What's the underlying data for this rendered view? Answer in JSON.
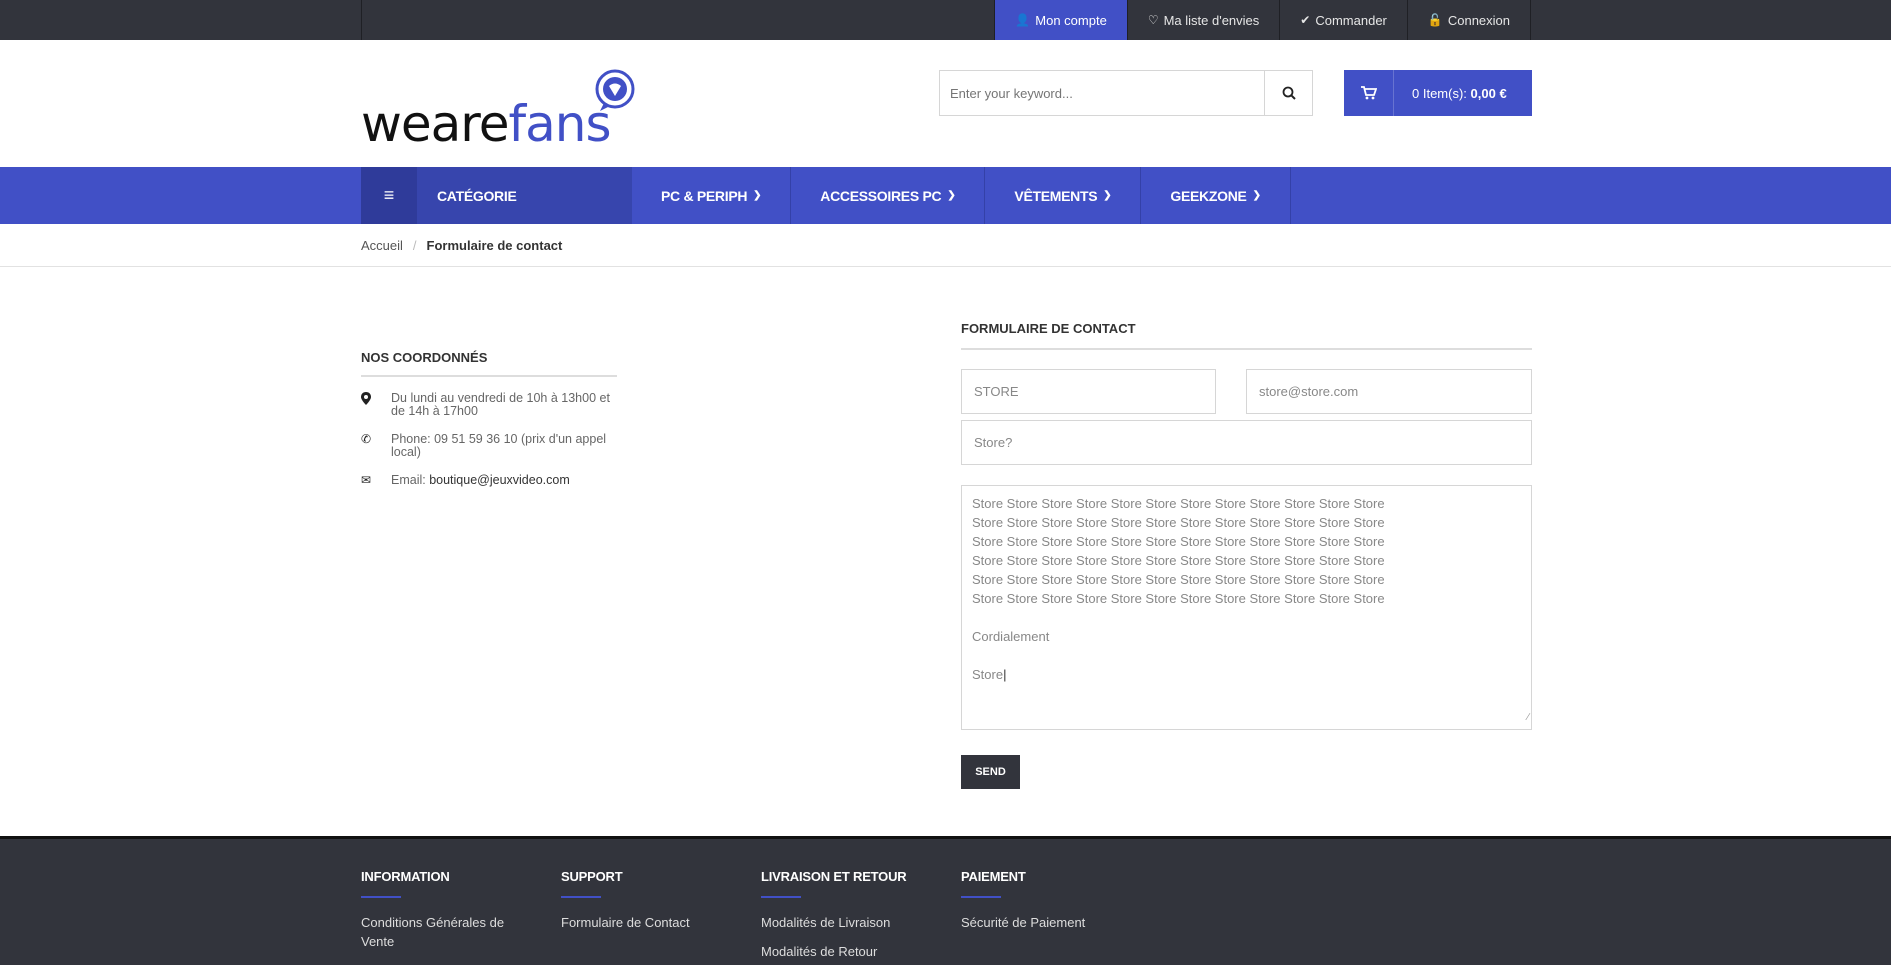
{
  "topbar": {
    "items": [
      {
        "label": "Mon compte",
        "icon": "user-icon"
      },
      {
        "label": "Ma liste d'envies",
        "icon": "heart-icon"
      },
      {
        "label": "Commander",
        "icon": "check-icon"
      },
      {
        "label": "Connexion",
        "icon": "lock-icon"
      }
    ],
    "accent": "#4150c6"
  },
  "header": {
    "logo_part1": "weare",
    "logo_part2": "fans",
    "search_placeholder": "Enter your keyword...",
    "cart_count": "0 Item(s):",
    "cart_total": "0,00 €"
  },
  "nav": {
    "category_label": "CATÉGORIE",
    "items": [
      "PC & PERIPH",
      "ACCESSOIRES PC",
      "VÊTEMENTS",
      "GEEKZONE"
    ]
  },
  "breadcrumb": {
    "home": "Accueil",
    "current": "Formulaire de contact"
  },
  "coords": {
    "title": "NOS COORDONNÉS",
    "hours": "Du lundi au vendredi de 10h à  13h00 et de 14h à 17h00",
    "phone": "Phone: 09 51 59 36 10 (prix d'un appel local)",
    "email_label": "Email: ",
    "email": "boutique@jeuxvideo.com"
  },
  "form": {
    "title": "FORMULAIRE DE CONTACT",
    "name_value": "STORE",
    "email_value": "store@store.com",
    "subject_value": "Store?",
    "message_lines": [
      "Store Store Store Store Store Store Store Store Store Store Store Store",
      "Store Store Store Store Store Store Store Store Store Store Store Store",
      "Store Store Store Store Store Store Store Store Store Store Store Store",
      "Store Store Store Store Store Store Store Store Store Store Store Store",
      "Store Store Store Store Store Store Store Store Store Store Store Store",
      "Store Store Store Store Store Store Store Store Store Store Store Store"
    ],
    "message_closing": "Cordialement",
    "message_signature": "Store",
    "send_label": "SEND"
  },
  "footer": {
    "columns": [
      {
        "title": "INFORMATION",
        "links": [
          "Conditions Générales de Vente"
        ]
      },
      {
        "title": "SUPPORT",
        "links": [
          "Formulaire de Contact"
        ]
      },
      {
        "title": "LIVRAISON ET RETOUR",
        "links": [
          "Modalités de Livraison",
          "Modalités de Retour"
        ]
      },
      {
        "title": "PAIEMENT",
        "links": [
          "Sécurité de Paiement"
        ]
      }
    ]
  }
}
